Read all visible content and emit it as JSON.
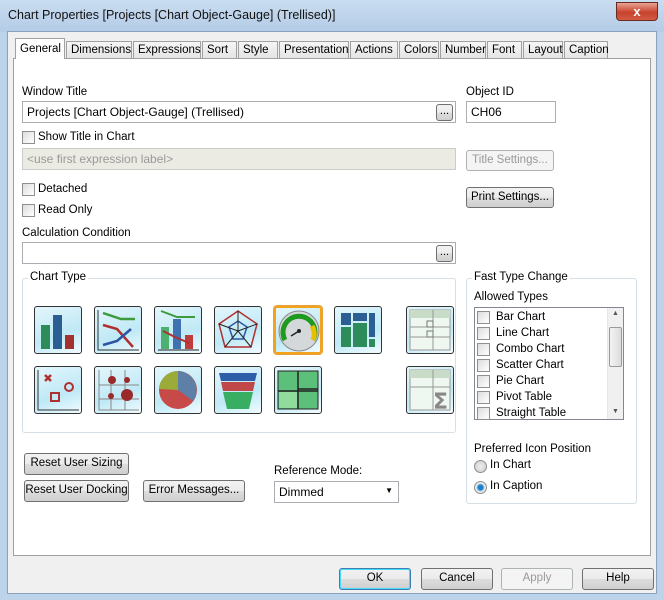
{
  "window": {
    "title": "Chart Properties [Projects [Chart Object-Gauge] (Trellised)]",
    "close": "x"
  },
  "tabs": [
    "General",
    "Dimensions",
    "Expressions",
    "Sort",
    "Style",
    "Presentation",
    "Actions",
    "Colors",
    "Number",
    "Font",
    "Layout",
    "Caption"
  ],
  "active_tab": "General",
  "general": {
    "window_title_label": "Window Title",
    "window_title_value": "Projects [Chart Object-Gauge] (Trellised)",
    "object_id_label": "Object ID",
    "object_id_value": "CH06",
    "show_title_label": "Show Title in Chart",
    "show_title_checked": false,
    "title_placeholder": "<use first expression label>",
    "title_settings": "Title Settings...",
    "print_settings": "Print Settings...",
    "detached_label": "Detached",
    "detached_checked": false,
    "read_only_label": "Read Only",
    "read_only_checked": false,
    "calc_condition_label": "Calculation Condition",
    "calc_condition_value": "",
    "ellipsis": "...",
    "chart_type_label": "Chart Type",
    "chart_types": [
      "bar-chart",
      "line-chart",
      "combo-chart",
      "radar-chart",
      "gauge-chart",
      "mekko-chart",
      "pivot-table",
      "scatter-chart",
      "grid-chart",
      "pie-chart",
      "funnel-chart",
      "block-chart",
      "straight-table"
    ],
    "selected_chart_type": "gauge-chart",
    "fast_type_label": "Fast Type Change",
    "allowed_types_label": "Allowed Types",
    "allowed_types": [
      {
        "label": "Bar Chart",
        "checked": false
      },
      {
        "label": "Line Chart",
        "checked": false
      },
      {
        "label": "Combo Chart",
        "checked": false
      },
      {
        "label": "Scatter Chart",
        "checked": false
      },
      {
        "label": "Pie Chart",
        "checked": false
      },
      {
        "label": "Pivot Table",
        "checked": false
      },
      {
        "label": "Straight Table",
        "checked": false
      }
    ],
    "icon_position_label": "Preferred Icon Position",
    "icon_positions": [
      "In Chart",
      "In Caption"
    ],
    "icon_position_selected": "In Caption",
    "reset_sizing": "Reset User Sizing",
    "reset_docking": "Reset User Docking",
    "error_messages": "Error Messages...",
    "reference_mode_label": "Reference Mode:",
    "reference_mode_value": "Dimmed"
  },
  "footer": {
    "ok": "OK",
    "cancel": "Cancel",
    "apply": "Apply",
    "help": "Help"
  }
}
